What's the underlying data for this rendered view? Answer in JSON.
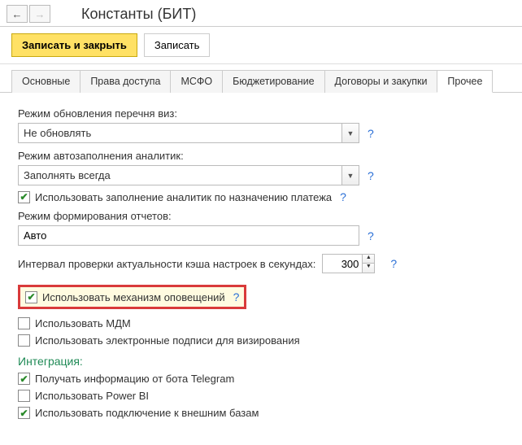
{
  "title": "Константы (БИТ)",
  "toolbar": {
    "save_close": "Записать и закрыть",
    "save": "Записать"
  },
  "tabs": [
    {
      "label": "Основные"
    },
    {
      "label": "Права доступа"
    },
    {
      "label": "МСФО"
    },
    {
      "label": "Бюджетирование"
    },
    {
      "label": "Договоры и закупки"
    },
    {
      "label": "Прочее"
    }
  ],
  "fields": {
    "visa_mode_label": "Режим обновления перечня виз:",
    "visa_mode_value": "Не обновлять",
    "analytics_mode_label": "Режим автозаполнения аналитик:",
    "analytics_mode_value": "Заполнять всегда",
    "fill_by_payment": "Использовать заполнение аналитик по назначению платежа",
    "report_mode_label": "Режим формирования отчетов:",
    "report_mode_value": "Авто",
    "interval_label": "Интервал проверки актуальности кэша настроек в секундах:",
    "interval_value": "300",
    "use_notifications": "Использовать механизм оповещений",
    "use_mdm": "Использовать МДМ",
    "use_esign": "Использовать электронные подписи для визирования"
  },
  "integration": {
    "title": "Интеграция:",
    "telegram": "Получать информацию от бота Telegram",
    "powerbi": "Использовать Power BI",
    "ext_db": "Использовать подключение к внешним базам"
  },
  "help": "?"
}
